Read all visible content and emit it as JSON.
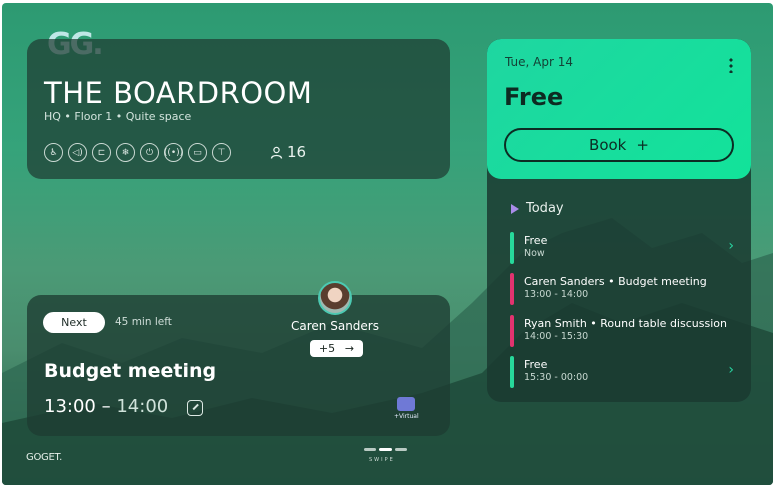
{
  "brand": {
    "logo": "GG.",
    "footer": "GOGET.",
    "swipe_hint": "SWIPE"
  },
  "room": {
    "title": "THE BOARDROOM",
    "subtitle": "HQ • Floor 1 • Quite space",
    "amenities": [
      "accessible-icon",
      "speaker-icon",
      "cast-icon",
      "ac-icon",
      "power-icon",
      "wireless-icon",
      "display-icon",
      "whiteboard-icon"
    ],
    "capacity": "16"
  },
  "next_meeting": {
    "badge": "Next",
    "countdown": "45 min left",
    "title": "Budget meeting",
    "start": "13:00",
    "separator": "–",
    "end": "14:00",
    "host": "Caren Sanders",
    "attendees_more": "+5",
    "virtual_label": "+Virtual"
  },
  "status_panel": {
    "date": "Tue, Apr 14",
    "state": "Free",
    "book_label": "Book",
    "book_icon": "+",
    "today_label": "Today",
    "accent": "#1fd6a1"
  },
  "schedule": [
    {
      "title": "Free",
      "time": "Now",
      "color": "#27d99b",
      "arrow": "›"
    },
    {
      "title": "Caren Sanders • Budget meeting",
      "time": "13:00 - 14:00",
      "color": "#e2336f",
      "arrow": ""
    },
    {
      "title": "Ryan Smith • Round table discussion",
      "time": "14:00 - 15:30",
      "color": "#e2336f",
      "arrow": ""
    },
    {
      "title": "Free",
      "time": "15:30 - 00:00",
      "color": "#27d99b",
      "arrow": "›"
    }
  ]
}
